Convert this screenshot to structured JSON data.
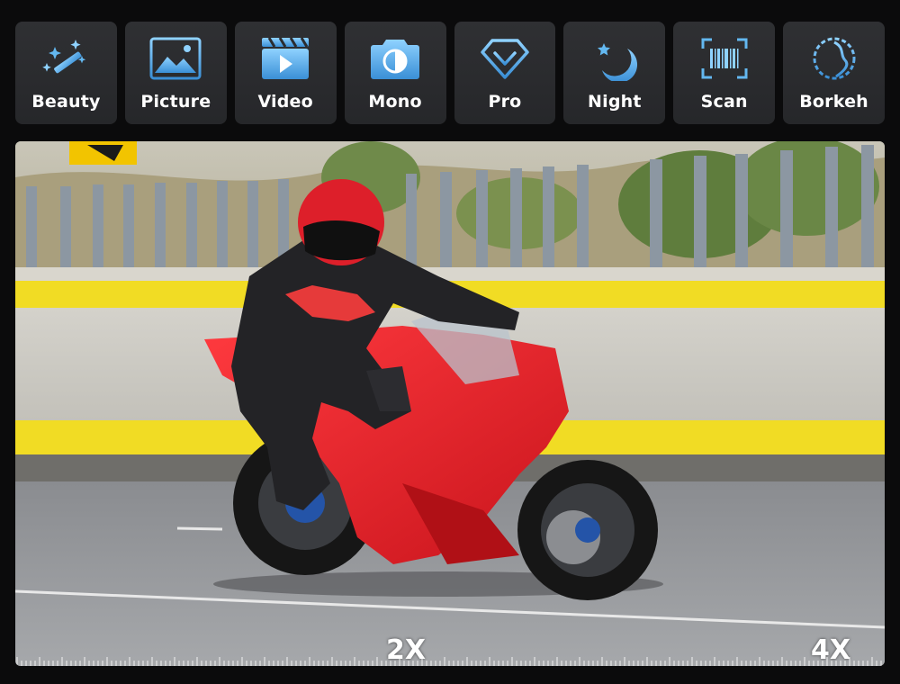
{
  "modes": [
    {
      "label": "Beauty",
      "icon": "magic-wand-icon"
    },
    {
      "label": "Picture",
      "icon": "picture-icon"
    },
    {
      "label": "Video",
      "icon": "video-icon"
    },
    {
      "label": "Mono",
      "icon": "camera-icon"
    },
    {
      "label": "Pro",
      "icon": "diamond-icon"
    },
    {
      "label": "Night",
      "icon": "moon-icon"
    },
    {
      "label": "Scan",
      "icon": "barcode-icon"
    },
    {
      "label": "Borkeh",
      "icon": "bokeh-icon"
    }
  ],
  "zoom": {
    "left_label": "2X",
    "right_label": "4X"
  },
  "colors": {
    "accent": "#63b8f0",
    "button_bg": "#2b2c2f",
    "page_bg": "#0b0b0c"
  }
}
